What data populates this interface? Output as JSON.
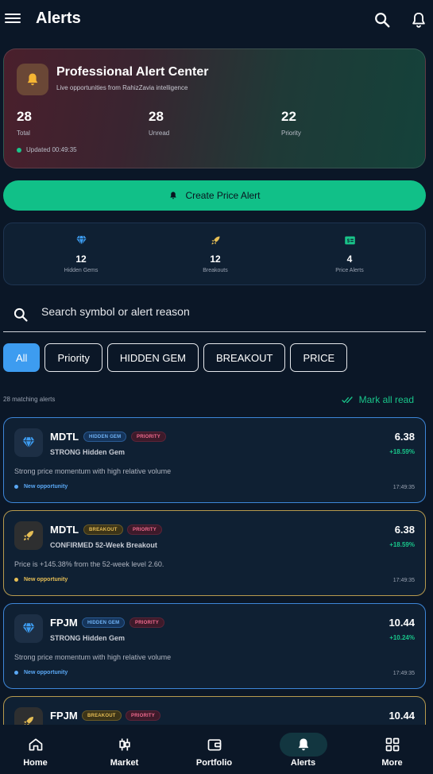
{
  "appbar": {
    "title": "Alerts"
  },
  "hero": {
    "title": "Professional Alert Center",
    "subtitle": "Live opportunities from RahizZavia intelligence",
    "stats": [
      {
        "value": "28",
        "label": "Total"
      },
      {
        "value": "28",
        "label": "Unread"
      },
      {
        "value": "22",
        "label": "Priority"
      }
    ],
    "updated": "Updated 00:49:35"
  },
  "create_button": {
    "label": "Create Price Alert"
  },
  "counts": [
    {
      "value": "12",
      "label": "Hidden Gems",
      "icon": "gem-icon"
    },
    {
      "value": "12",
      "label": "Breakouts",
      "icon": "rocket-icon"
    },
    {
      "value": "4",
      "label": "Price Alerts",
      "icon": "price-tag-icon"
    }
  ],
  "search": {
    "placeholder": "Search symbol or alert reason"
  },
  "filters": [
    "All",
    "Priority",
    "HIDDEN GEM",
    "BREAKOUT",
    "PRICE"
  ],
  "list_header": {
    "matching": "28 matching alerts",
    "mark_all": "Mark all read"
  },
  "alerts": [
    {
      "symbol": "MDTL",
      "type_badge": "HIDDEN GEM",
      "priority_badge": "PRIORITY",
      "title": "STRONG Hidden Gem",
      "price": "6.38",
      "change": "+18.59%",
      "reason": "Strong price momentum with high relative volume",
      "status": "New opportunity",
      "time": "17:49:35",
      "kind": "gem"
    },
    {
      "symbol": "MDTL",
      "type_badge": "BREAKOUT",
      "priority_badge": "PRIORITY",
      "title": "CONFIRMED 52-Week Breakout",
      "price": "6.38",
      "change": "+18.59%",
      "reason": "Price is +145.38% from the 52-week level 2.60.",
      "status": "New opportunity",
      "time": "17:49:35",
      "kind": "breakout"
    },
    {
      "symbol": "FPJM",
      "type_badge": "HIDDEN GEM",
      "priority_badge": "PRIORITY",
      "title": "STRONG Hidden Gem",
      "price": "10.44",
      "change": "+10.24%",
      "reason": "Strong price momentum with high relative volume",
      "status": "New opportunity",
      "time": "17:49:35",
      "kind": "gem"
    },
    {
      "symbol": "FPJM",
      "type_badge": "BREAKOUT",
      "priority_badge": "PRIORITY",
      "title": "",
      "price": "10.44",
      "change": "",
      "reason": "",
      "status": "",
      "time": "",
      "kind": "breakout"
    }
  ],
  "bottom_nav": [
    {
      "label": "Home",
      "icon": "home-icon"
    },
    {
      "label": "Market",
      "icon": "candlestick-icon"
    },
    {
      "label": "Portfolio",
      "icon": "wallet-icon"
    },
    {
      "label": "Alerts",
      "icon": "bell-icon",
      "active": true
    },
    {
      "label": "More",
      "icon": "grid-icon"
    }
  ],
  "colors": {
    "background": "#0b1727",
    "accent_green": "#11c088",
    "accent_blue": "#3d9cf0",
    "priority_pink": "#f06a8e",
    "breakout_gold": "#e6be55"
  }
}
